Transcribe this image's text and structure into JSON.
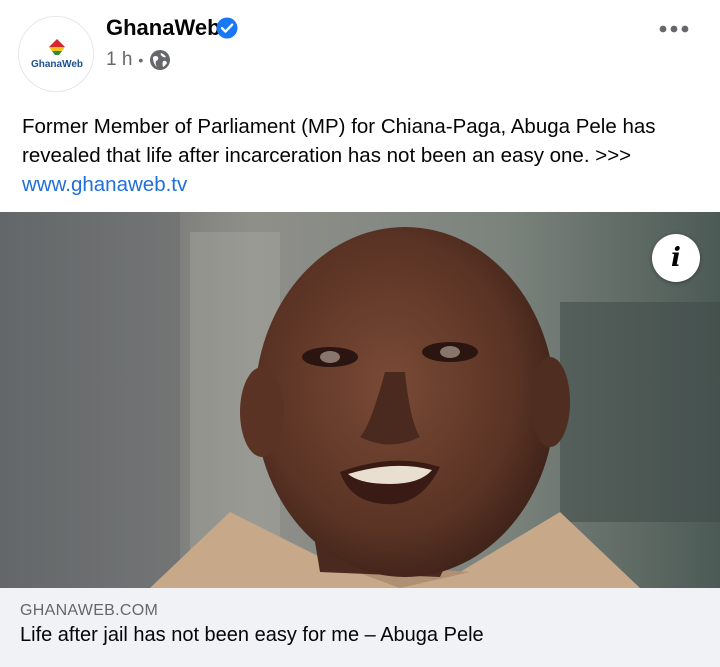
{
  "post": {
    "page_name": "GhanaWeb",
    "avatar_logo_text": "GhanaWeb",
    "time_ago": "1 h",
    "separator": "•",
    "privacy_icon": "globe-icon",
    "verified_icon": "verified-badge-icon",
    "more_icon": "more-options-icon",
    "text": "Former Member of Parliament (MP) for Chiana-Paga, Abuga Pele has revealed that life after incarceration has not been an easy one. >>>",
    "link_text": "www.ghanaweb.tv"
  },
  "media": {
    "info_icon": "info-icon",
    "info_label": "i"
  },
  "link_preview": {
    "domain": "GHANAWEB.COM",
    "title": "Life after jail has not been easy for me – Abuga Pele"
  },
  "colors": {
    "link": "#216fdb",
    "verified": "#1877f2",
    "secondary_text": "#65676b",
    "preview_bg": "#f0f2f5"
  }
}
